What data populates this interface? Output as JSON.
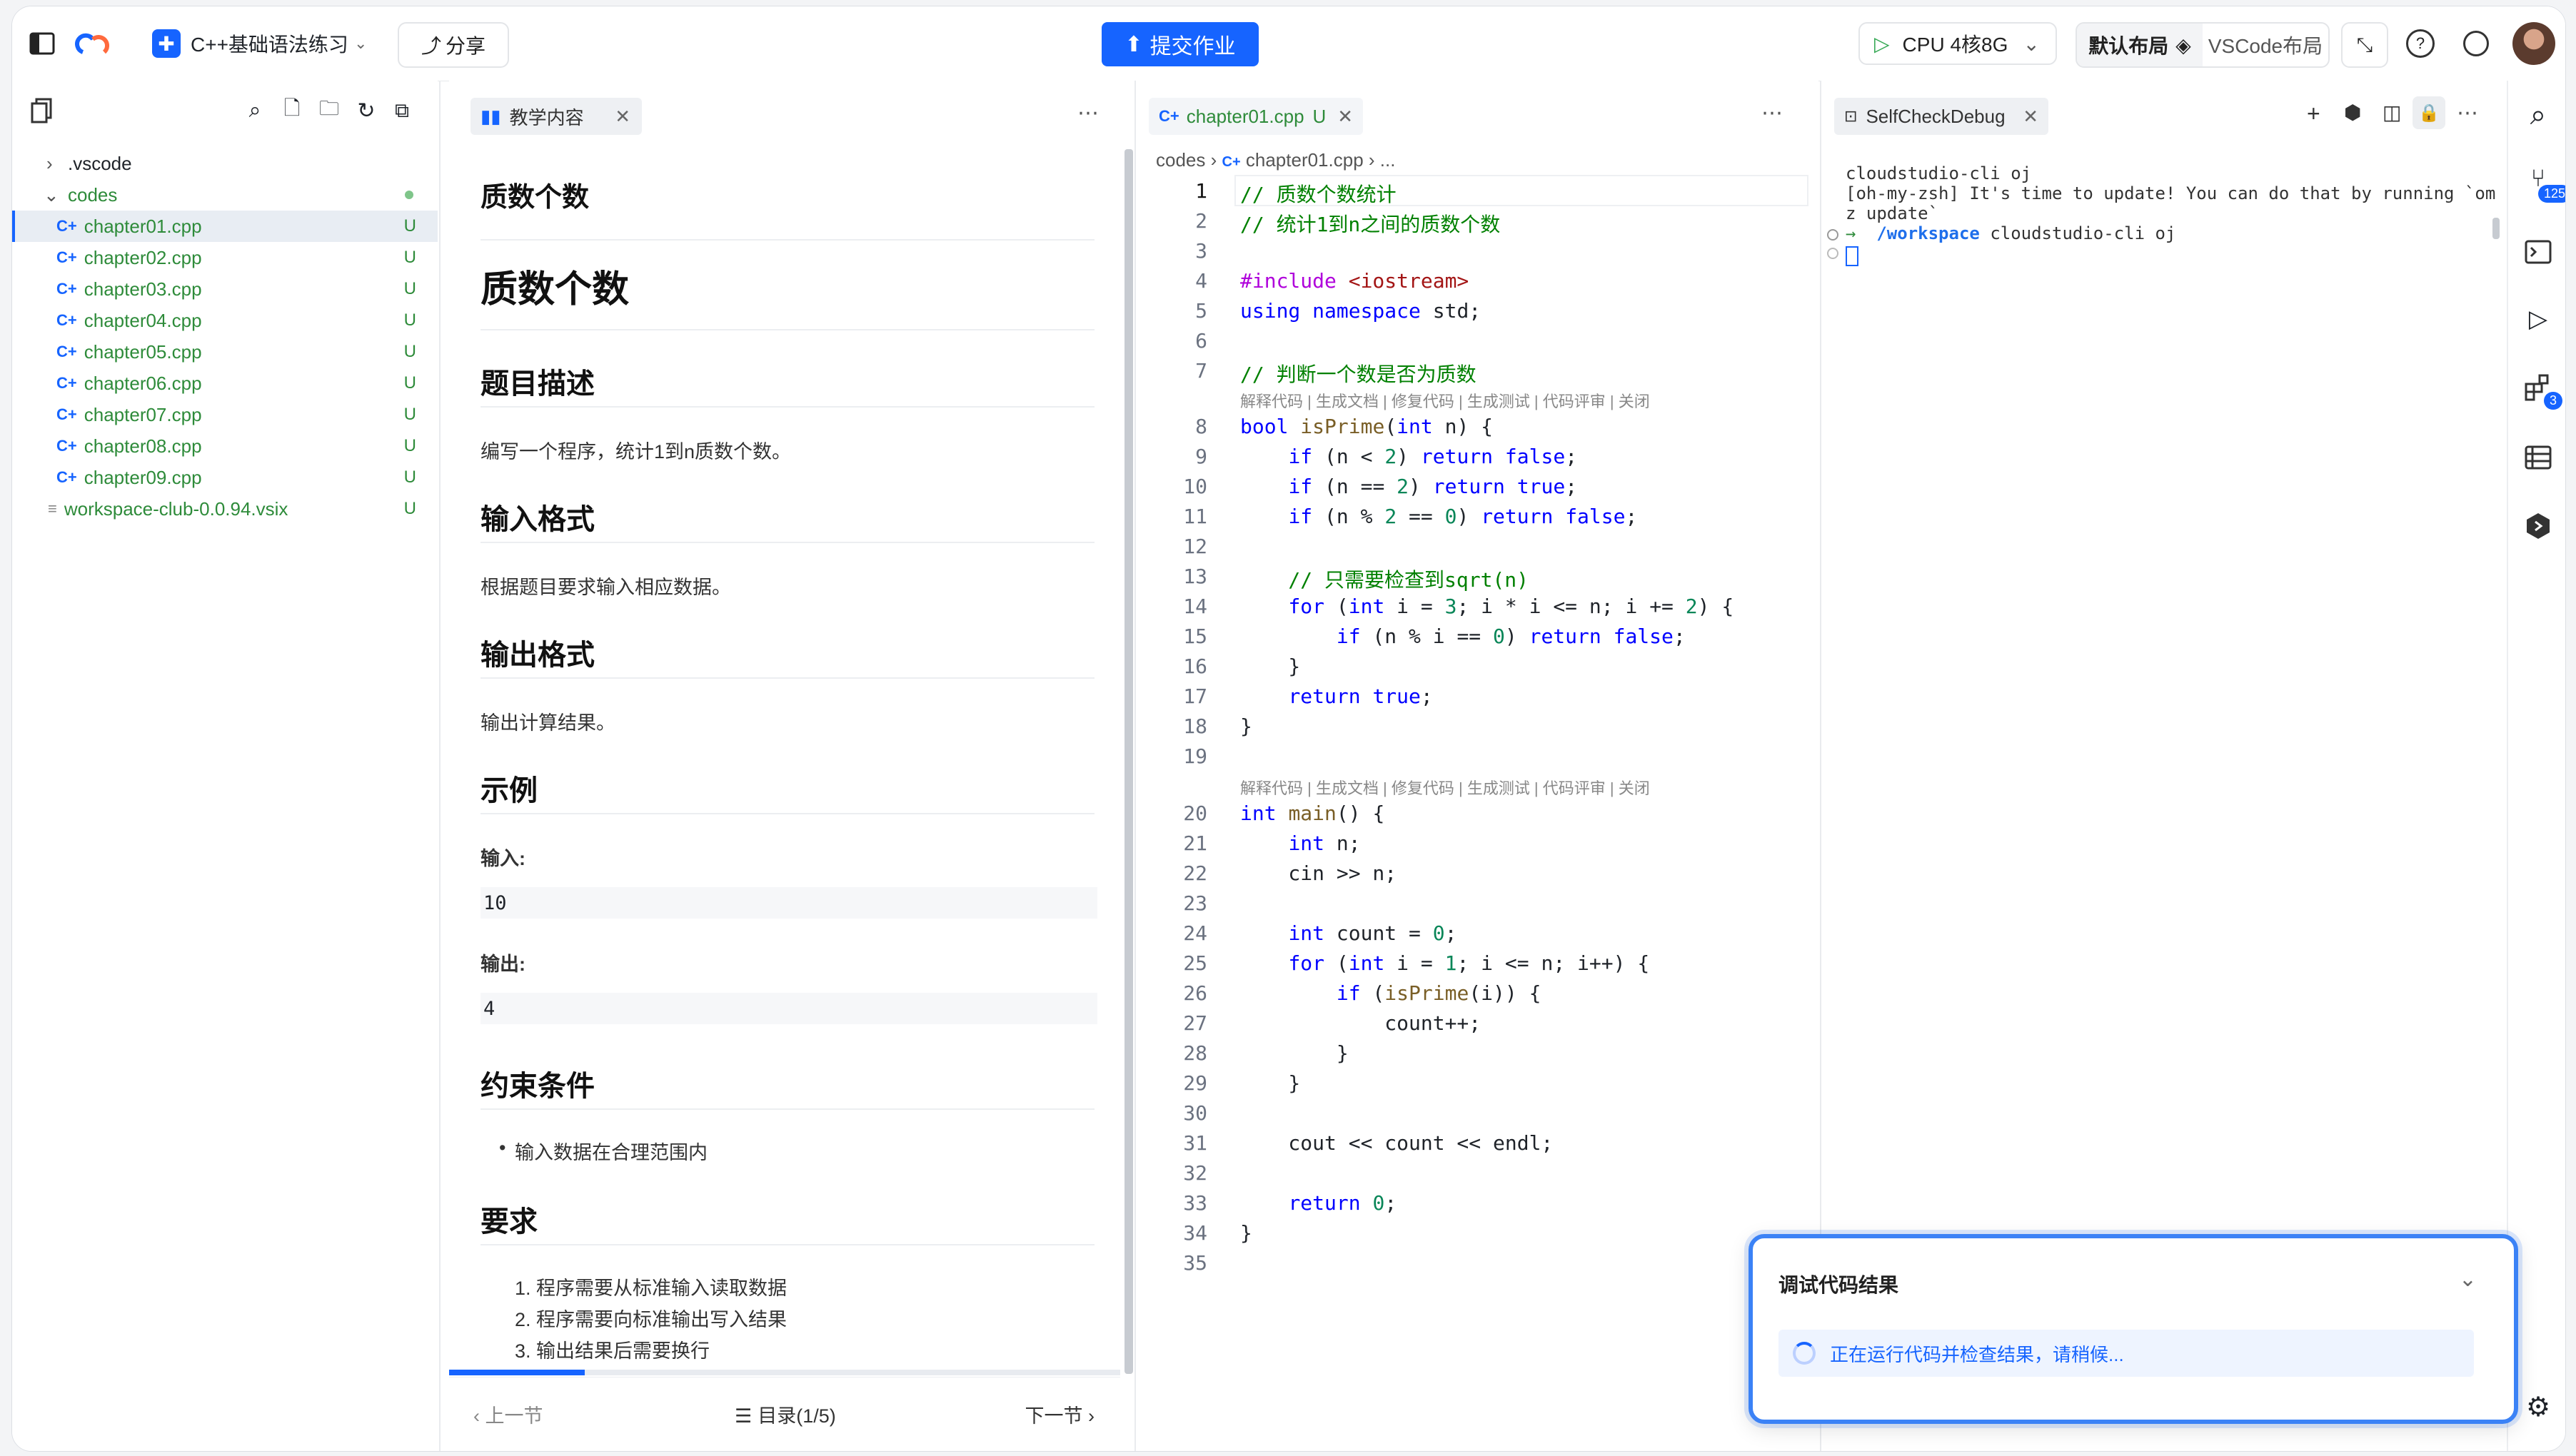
{
  "topbar": {
    "project_name": "C++基础语法练习",
    "share_label": "分享",
    "submit_label": "提交作业",
    "cpu_label": "CPU 4核8G",
    "layout_default": "默认布局",
    "layout_vscode": "VSCode布局"
  },
  "explorer": {
    "items": [
      {
        "name": ".vscode",
        "kind": "folder"
      },
      {
        "name": "codes",
        "kind": "folder-open"
      },
      {
        "name": "chapter01.cpp",
        "status": "U"
      },
      {
        "name": "chapter02.cpp",
        "status": "U"
      },
      {
        "name": "chapter03.cpp",
        "status": "U"
      },
      {
        "name": "chapter04.cpp",
        "status": "U"
      },
      {
        "name": "chapter05.cpp",
        "status": "U"
      },
      {
        "name": "chapter06.cpp",
        "status": "U"
      },
      {
        "name": "chapter07.cpp",
        "status": "U"
      },
      {
        "name": "chapter08.cpp",
        "status": "U"
      },
      {
        "name": "chapter09.cpp",
        "status": "U"
      },
      {
        "name": "workspace-club-0.0.94.vsix",
        "status": "U"
      }
    ]
  },
  "doc": {
    "tab_label": "教学内容",
    "small_title": "质数个数",
    "title": "质数个数",
    "h_desc": "题目描述",
    "desc": "编写一个程序，统计1到n质数个数。",
    "h_input": "输入格式",
    "input": "根据题目要求输入相应数据。",
    "h_output": "输出格式",
    "output": "输出计算结果。",
    "h_example": "示例",
    "ex_in_label": "输入:",
    "ex_in": "10",
    "ex_out_label": "输出:",
    "ex_out": "4",
    "h_constraints": "约束条件",
    "constraint_1": "输入数据在合理范围内",
    "h_requirements": "要求",
    "req_1": "1. 程序需要从标准输入读取数据",
    "req_2": "2. 程序需要向标准输出写入结果",
    "req_3": "3. 输出结果后需要换行",
    "prev": "上一节",
    "toc": "目录(1/5)",
    "next": "下一节"
  },
  "editor": {
    "tab_label": "chapter01.cpp",
    "tab_status": "U",
    "crumb_1": "codes",
    "crumb_2": "chapter01.cpp",
    "crumb_3": "...",
    "codelens": "解释代码 | 生成文档 | 修复代码 | 生成测试 | 代码评审 | 关闭"
  },
  "terminal": {
    "tab_label": "SelfCheckDebug",
    "line_1": "cloudstudio-cli oj",
    "line_2": "[oh-my-zsh] It's time to update! You can do that by running `om",
    "line_3": "z update`",
    "prompt_dir": "/workspace",
    "prompt_cmd": "cloudstudio-cli oj"
  },
  "activity": {
    "badge_scm": "125",
    "badge_ext": "3"
  },
  "popup": {
    "title": "调试代码结果",
    "status": "正在运行代码并检查结果，请稍候..."
  },
  "colors": {
    "accent": "#1664ff",
    "git_untracked": "#2e8b3a"
  }
}
